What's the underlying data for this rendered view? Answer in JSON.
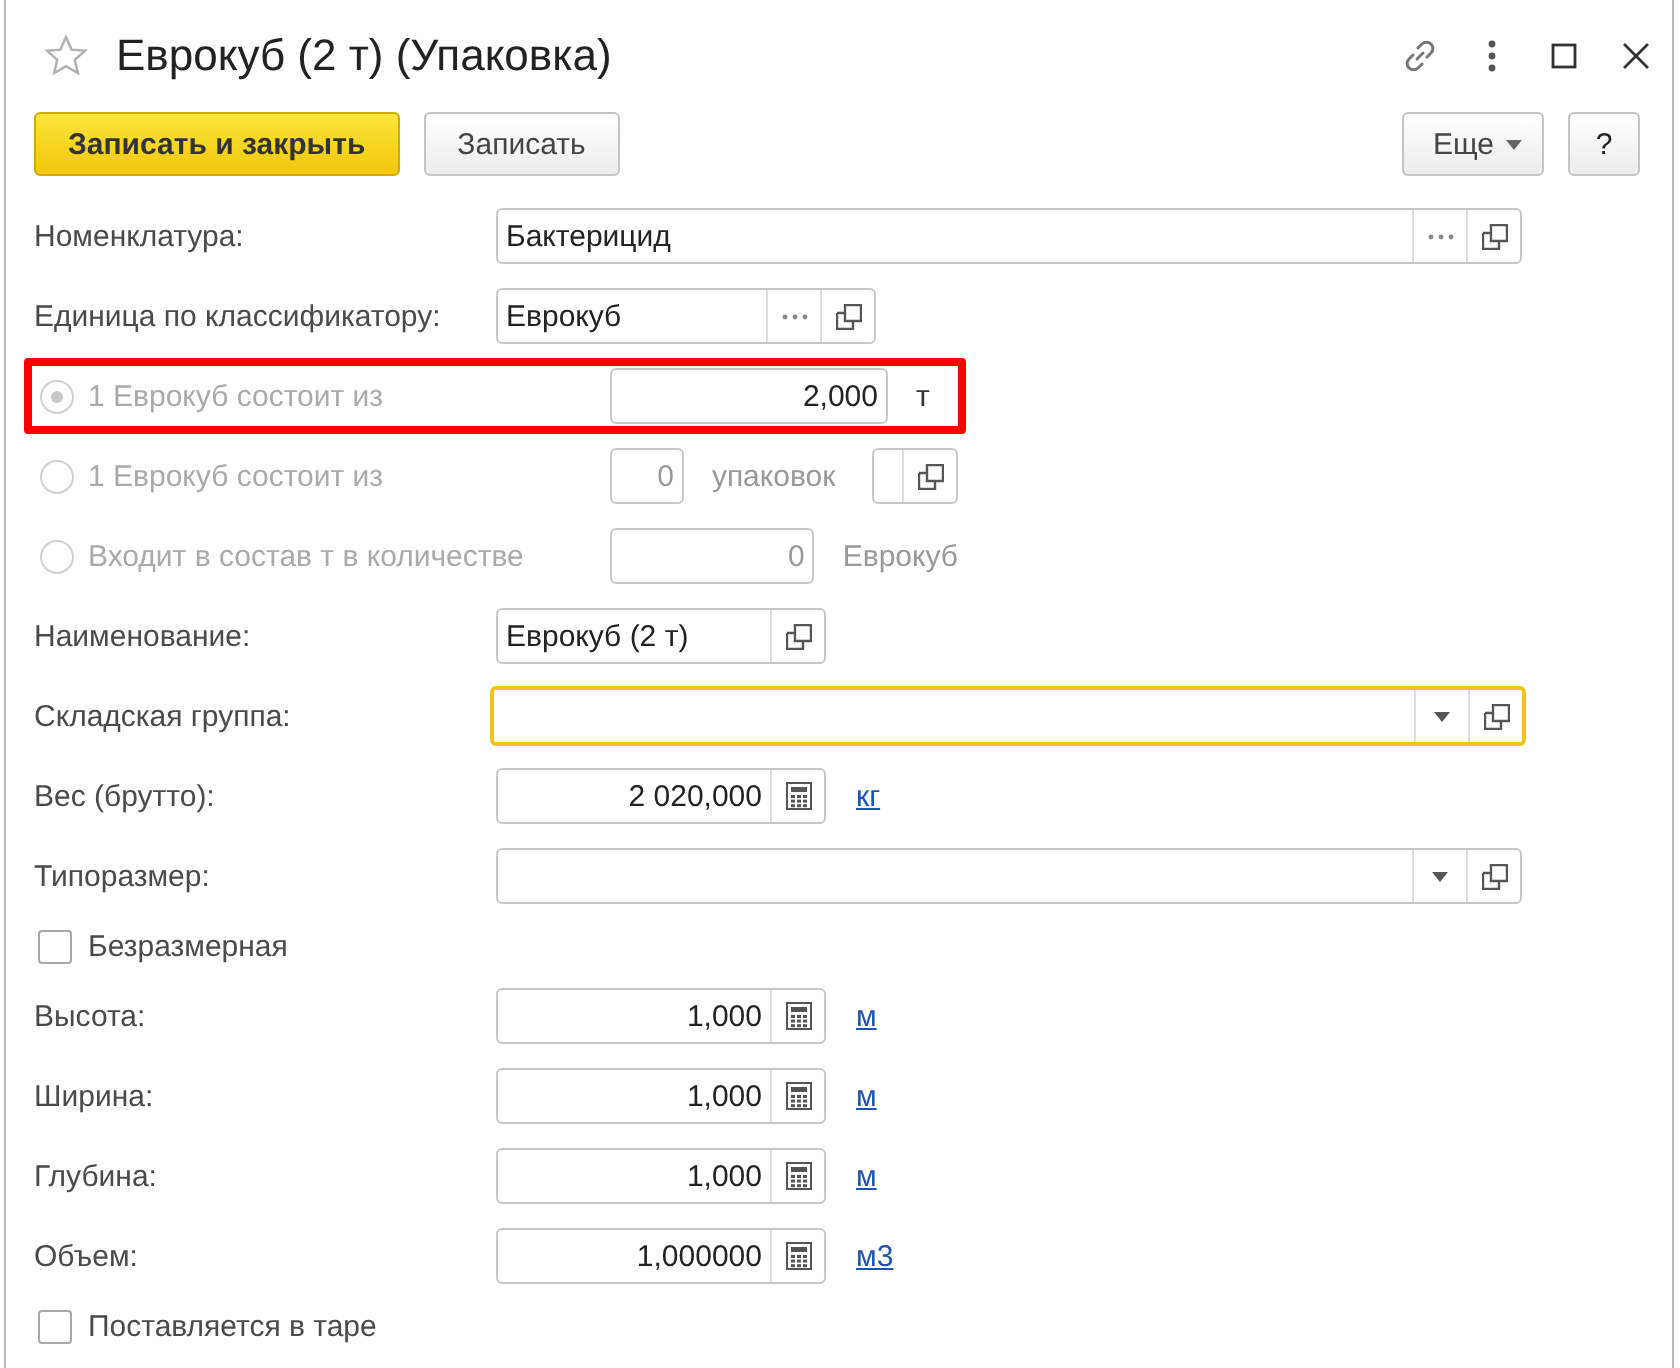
{
  "window": {
    "title": "Еврокуб (2 т) (Упаковка)",
    "favorite": false
  },
  "toolbar": {
    "buttons": [
      {
        "label": "Записать и закрыть",
        "kind": "primary"
      },
      {
        "label": "Записать",
        "kind": "default"
      }
    ],
    "more": "Еще",
    "help": "?"
  },
  "rows": [
    {
      "kind": "field",
      "label": "Номенклатура:",
      "value": "Бактерицид",
      "buttons": [
        {
          "kind": "select"
        },
        {
          "kind": "open"
        }
      ],
      "focused": false
    },
    {
      "kind": "field",
      "label": "Единица по классификатору:",
      "value": "Еврокуб",
      "buttons": [
        {
          "kind": "select"
        },
        {
          "kind": "open"
        }
      ],
      "focused": false
    },
    {
      "kind": "radio",
      "label": "1 Еврокуб состоит из",
      "selected": true,
      "highlighted": true,
      "field_disabled": false,
      "value": "2,000",
      "unit": "т"
    },
    {
      "kind": "radio",
      "label": "1 Еврокуб состоит из",
      "selected": false,
      "highlighted": false,
      "field_disabled": true,
      "value": "0",
      "unit": "упаковок",
      "unit_field": {
        "buttons": [
          {
            "kind": "open"
          }
        ]
      }
    },
    {
      "kind": "radio",
      "label": "Входит в состав т в количестве",
      "selected": false,
      "highlighted": false,
      "field_disabled": true,
      "value": "0",
      "unit": "Еврокуб"
    },
    {
      "kind": "field",
      "label": "Наименование:",
      "value": "Еврокуб (2 т)",
      "buttons": [
        {
          "kind": "open"
        }
      ],
      "focused": false
    },
    {
      "kind": "field",
      "label": "Складская группа:",
      "buttons": [
        {
          "kind": "dropdown"
        },
        {
          "kind": "open"
        }
      ],
      "focused": true
    },
    {
      "kind": "number",
      "label": "Вес (брутто):",
      "value": "2 020,000",
      "link": "кг"
    },
    {
      "kind": "field",
      "label": "Типоразмер:",
      "buttons": [
        {
          "kind": "dropdown"
        },
        {
          "kind": "open"
        }
      ],
      "focused": false
    },
    {
      "kind": "checkbox",
      "label": "Безразмерная",
      "checked": false
    },
    {
      "kind": "number",
      "label": "Высота:",
      "value": "1,000",
      "link": "м"
    },
    {
      "kind": "number",
      "label": "Ширина:",
      "value": "1,000",
      "link": "м"
    },
    {
      "kind": "number",
      "label": "Глубина:",
      "value": "1,000",
      "link": "м"
    },
    {
      "kind": "number",
      "label": "Объем:",
      "value": "1,000000",
      "link": "м3"
    },
    {
      "kind": "checkbox",
      "label": "Поставляется в таре",
      "checked": false
    }
  ]
}
